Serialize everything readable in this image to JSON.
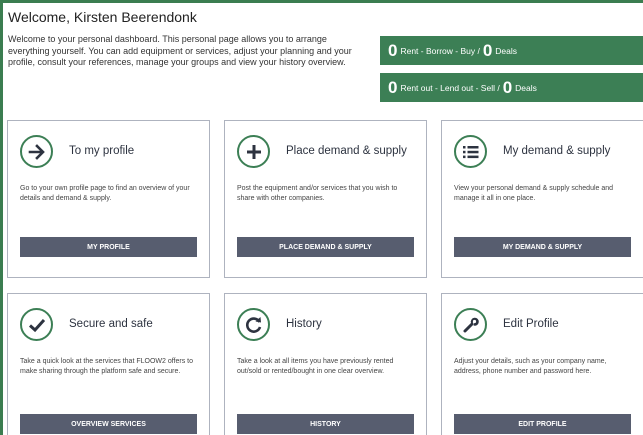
{
  "header": {
    "title": "Welcome, Kirsten Beerendonk",
    "intro": "Welcome to your personal dashboard. This personal page allows you to arrange everything yourself. You can add equipment or services, adjust your planning and your profile, consult your references, manage your groups and view your history overview."
  },
  "deals": [
    {
      "count_left": "0",
      "label": "Rent - Borrow - Buy /",
      "count_right": "0",
      "suffix": "Deals"
    },
    {
      "count_left": "0",
      "label": "Rent out - Lend out - Sell /",
      "count_right": "0",
      "suffix": "Deals"
    }
  ],
  "cards": [
    {
      "title": "To my profile",
      "icon": "arrow-right-icon",
      "desc": "Go to your own profile page to find an overview of your details and demand & supply.",
      "button": "My profile"
    },
    {
      "title": "Place demand & supply",
      "icon": "plus-icon",
      "desc": "Post the equipment and/or services that you wish to share with other companies.",
      "button": "Place demand & supply"
    },
    {
      "title": "My demand & supply",
      "icon": "list-icon",
      "desc": "View your personal demand & supply schedule and manage it all in one place.",
      "button": "My demand & supply"
    },
    {
      "title": "Secure and safe",
      "icon": "checkmark-icon",
      "desc": "Take a quick look at the services that FLOOW2 offers to make sharing through the platform safe and secure.",
      "button": "Overview services"
    },
    {
      "title": "History",
      "icon": "refresh-icon",
      "desc": "Take a look at all items you have previously rented out/sold or rented/bought in one clear overview.",
      "button": "History"
    },
    {
      "title": "Edit Profile",
      "icon": "wrench-icon",
      "desc": "Adjust your details, such as your company name, address, phone number and password here.",
      "button": "Edit profile"
    }
  ],
  "colors": {
    "accent": "#3c7f55",
    "button": "#575d6f",
    "border": "#aeb3bf"
  }
}
